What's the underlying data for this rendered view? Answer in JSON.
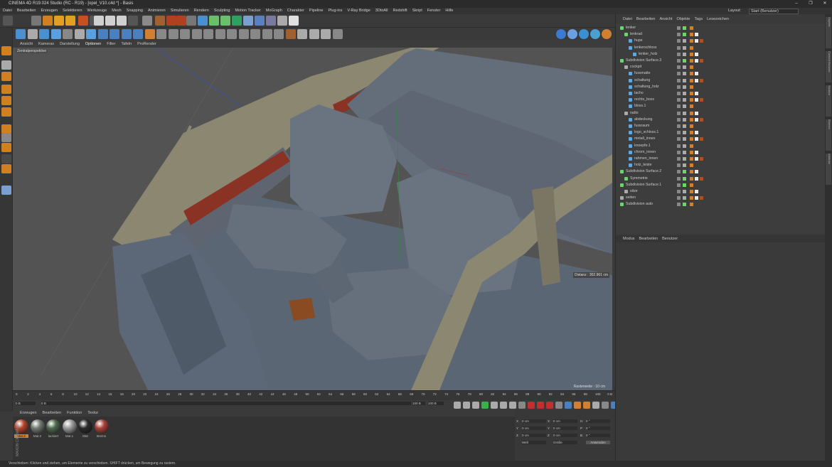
{
  "window": {
    "title": "CINEMA 4D R19.024 Studio (RC - R19) - [opel_V10.c4d *] - Basis",
    "controls": [
      "–",
      "❐",
      "✕"
    ]
  },
  "menubar": {
    "items": [
      "Datei",
      "Bearbeiten",
      "Erzeugen",
      "Selektieren",
      "Werkzeuge",
      "Mesh",
      "Snapping",
      "Animieren",
      "Simulieren",
      "Rendern",
      "Sculpting",
      "Motion Tracker",
      "MoGraph",
      "Charakter",
      "Pipeline",
      "Plug-ins",
      "V-Ray Bridge",
      "3DtoAll",
      "Redshift",
      "Skript",
      "Fenster",
      "Hilfe"
    ],
    "layout_label": "Layout:",
    "layout_value": "Start (Benutzer)"
  },
  "viewport": {
    "menu": [
      "Ansicht",
      "Kameras",
      "Darstellung",
      "Optionen",
      "Filter",
      "Tafeln",
      "ProRender"
    ],
    "label": "Zentralperspektive",
    "distance": "Distanz : 302.961 cm",
    "raster": "Rasterweite : 10 cm"
  },
  "timeline": {
    "ticks": [
      "0",
      "2",
      "4",
      "6",
      "8",
      "10",
      "12",
      "14",
      "16",
      "18",
      "20",
      "22",
      "24",
      "26",
      "28",
      "30",
      "32",
      "34",
      "36",
      "38",
      "40",
      "42",
      "44",
      "46",
      "48",
      "50",
      "52",
      "54",
      "56",
      "58",
      "60",
      "62",
      "64",
      "66",
      "68",
      "70",
      "72",
      "74",
      "76",
      "78",
      "80",
      "82",
      "84",
      "86",
      "88",
      "90",
      "92",
      "94",
      "96",
      "98",
      "100"
    ],
    "frame_end": "0 B",
    "start": "0 B",
    "current": "0 B",
    "end_a": "100 B",
    "end_b": "100 B"
  },
  "materials": {
    "tabs": [
      "Erzeugen",
      "Bearbeiten",
      "Funktion",
      "Textur"
    ],
    "items": [
      {
        "name": "Mat.3",
        "color": "#b5462e"
      },
      {
        "name": "Mat.2",
        "color": "#737a70"
      },
      {
        "name": "lackiert",
        "color": "#4f6a4e"
      },
      {
        "name": "Mat.1",
        "color": "#9a9a9a"
      },
      {
        "name": "Mat",
        "color": "#2a2a2a"
      },
      {
        "name": "Brems",
        "color": "#a84238"
      }
    ]
  },
  "coords": {
    "rows": [
      {
        "a": "X",
        "v1": "0 cm",
        "b": "X",
        "v2": "0 cm",
        "c": "H",
        "v3": "0 °"
      },
      {
        "a": "Y",
        "v1": "0 cm",
        "b": "Y",
        "v2": "0 cm",
        "c": "P",
        "v3": "0 °"
      },
      {
        "a": "Z",
        "v1": "0 cm",
        "b": "Z",
        "v2": "0 cm",
        "c": "B",
        "v3": "0 °"
      }
    ],
    "mode1": "Welt",
    "mode2": "Größe",
    "apply": "Anwenden"
  },
  "objects": {
    "menu": [
      "Datei",
      "Bearbeiten",
      "Ansicht",
      "Objekte",
      "Tags",
      "Lesezeichen"
    ],
    "rows": [
      {
        "name": "lenker",
        "indent": 0,
        "color": "#6fd36f"
      },
      {
        "name": "lenkrad",
        "indent": 1,
        "color": "#6fd36f"
      },
      {
        "name": "hupe",
        "indent": 2,
        "color": "#5fa8e0"
      },
      {
        "name": "lenkerschloss",
        "indent": 2,
        "color": "#5fa8e0"
      },
      {
        "name": "lenker_holz",
        "indent": 3,
        "color": "#5fa8e0"
      },
      {
        "name": "Subdivision Surface.3",
        "indent": 0,
        "color": "#6fd36f"
      },
      {
        "name": "cockpit",
        "indent": 1,
        "color": "#aaa"
      },
      {
        "name": "fussmatte",
        "indent": 2,
        "color": "#5fa8e0"
      },
      {
        "name": "schaltung",
        "indent": 2,
        "color": "#5fa8e0"
      },
      {
        "name": "schaltung_holz",
        "indent": 2,
        "color": "#5fa8e0"
      },
      {
        "name": "tacho",
        "indent": 2,
        "color": "#5fa8e0"
      },
      {
        "name": "rechts_boxx",
        "indent": 2,
        "color": "#5fa8e0"
      },
      {
        "name": "bloss.1",
        "indent": 2,
        "color": "#5fa8e0"
      },
      {
        "name": "radio",
        "indent": 1,
        "color": "#aaa"
      },
      {
        "name": "abdeckung",
        "indent": 2,
        "color": "#5fa8e0"
      },
      {
        "name": "fussraum",
        "indent": 2,
        "color": "#5fa8e0"
      },
      {
        "name": "logo_schloss.1",
        "indent": 2,
        "color": "#5fa8e0"
      },
      {
        "name": "metall_innen",
        "indent": 2,
        "color": "#5fa8e0"
      },
      {
        "name": "knoepfe.1",
        "indent": 2,
        "color": "#5fa8e0"
      },
      {
        "name": "chrom_innen",
        "indent": 2,
        "color": "#5fa8e0"
      },
      {
        "name": "rahmen_innen",
        "indent": 2,
        "color": "#5fa8e0"
      },
      {
        "name": "holz_leiste",
        "indent": 2,
        "color": "#5fa8e0"
      },
      {
        "name": "Subdivision Surface.2",
        "indent": 0,
        "color": "#6fd36f"
      },
      {
        "name": "Symmetrie",
        "indent": 1,
        "color": "#6fd36f"
      },
      {
        "name": "Subdivision Surface.1",
        "indent": 0,
        "color": "#6fd36f"
      },
      {
        "name": "sitze",
        "indent": 1,
        "color": "#aaa"
      },
      {
        "name": "seiten",
        "indent": 0,
        "color": "#aaa"
      },
      {
        "name": "Subdivision auto",
        "indent": 0,
        "color": "#6fd36f"
      }
    ]
  },
  "attributes": {
    "menu": [
      "Modus",
      "Bearbeiten",
      "Benutzer"
    ]
  },
  "side_tabs": [
    "Objekte",
    "Content Browser",
    "Struktur",
    "Ebenen",
    "Attribute"
  ],
  "status": "Verschieben: Klicken und ziehen, um Elemente zu verschieben. SHIFT drücken, um Bewegung zu rastern.",
  "brand": "MAXON CINEMA4D"
}
